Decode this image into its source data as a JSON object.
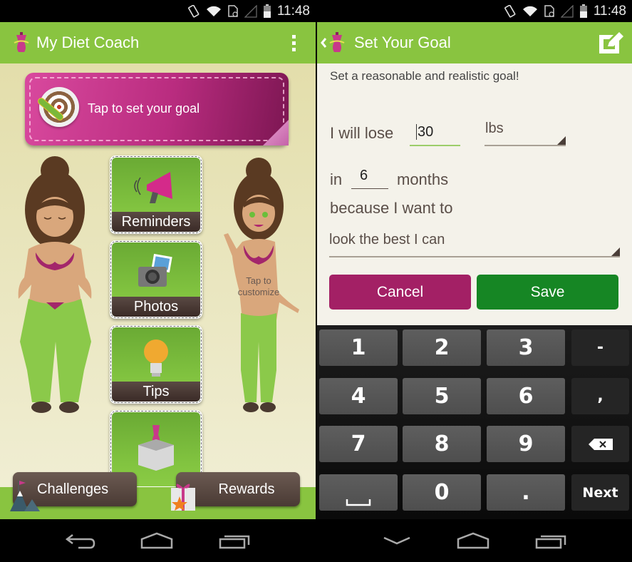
{
  "status_bar": {
    "time": "11:48",
    "icons": [
      "rotate-icon",
      "wifi-icon",
      "sim-icon",
      "signal-icon",
      "battery-icon"
    ]
  },
  "left_screen": {
    "app_title": "My Diet Coach",
    "menu_icon": "overflow-menu-icon",
    "goal_banner": {
      "label": "Tap to set your goal",
      "icon": "target-dart-icon"
    },
    "tiles": [
      {
        "label": "Reminders",
        "icon": "megaphone-icon"
      },
      {
        "label": "Photos",
        "icon": "camera-icon"
      },
      {
        "label": "Tips",
        "icon": "lightbulb-icon"
      },
      {
        "label": "",
        "icon": "gift-box-icon"
      }
    ],
    "avatar_hint": {
      "line1": "Tap to",
      "line2": "customize"
    },
    "bottom_buttons": [
      {
        "label": "Challenges",
        "icon": "mountain-flag-icon"
      },
      {
        "label": "Rewards",
        "icon": "gift-star-icon"
      }
    ]
  },
  "right_screen": {
    "title": "Set Your Goal",
    "back_icon": "back-chevron-icon",
    "edit_icon": "edit-icon",
    "subtitle": "Set a reasonable and realistic goal!",
    "form": {
      "lose_prefix": "I will lose",
      "lose_value": "30",
      "unit_selected": "lbs",
      "in_prefix": "in",
      "months_value": "6",
      "months_suffix": "months",
      "because_text": "because I want to",
      "reason_selected": "look the best I can"
    },
    "buttons": {
      "cancel": "Cancel",
      "save": "Save"
    },
    "keyboard": {
      "rows": [
        [
          "1",
          "2",
          "3",
          "-"
        ],
        [
          "4",
          "5",
          "6",
          ","
        ],
        [
          "7",
          "8",
          "9",
          "⌫"
        ],
        [
          "␣",
          "0",
          ".",
          "Next"
        ]
      ]
    }
  },
  "colors": {
    "action_bar_green": "#89c440",
    "banner_pink": "#b92c7f",
    "cancel_magenta": "#a32065",
    "save_green": "#168624",
    "tile_caption_brown": "#4a3a34"
  }
}
